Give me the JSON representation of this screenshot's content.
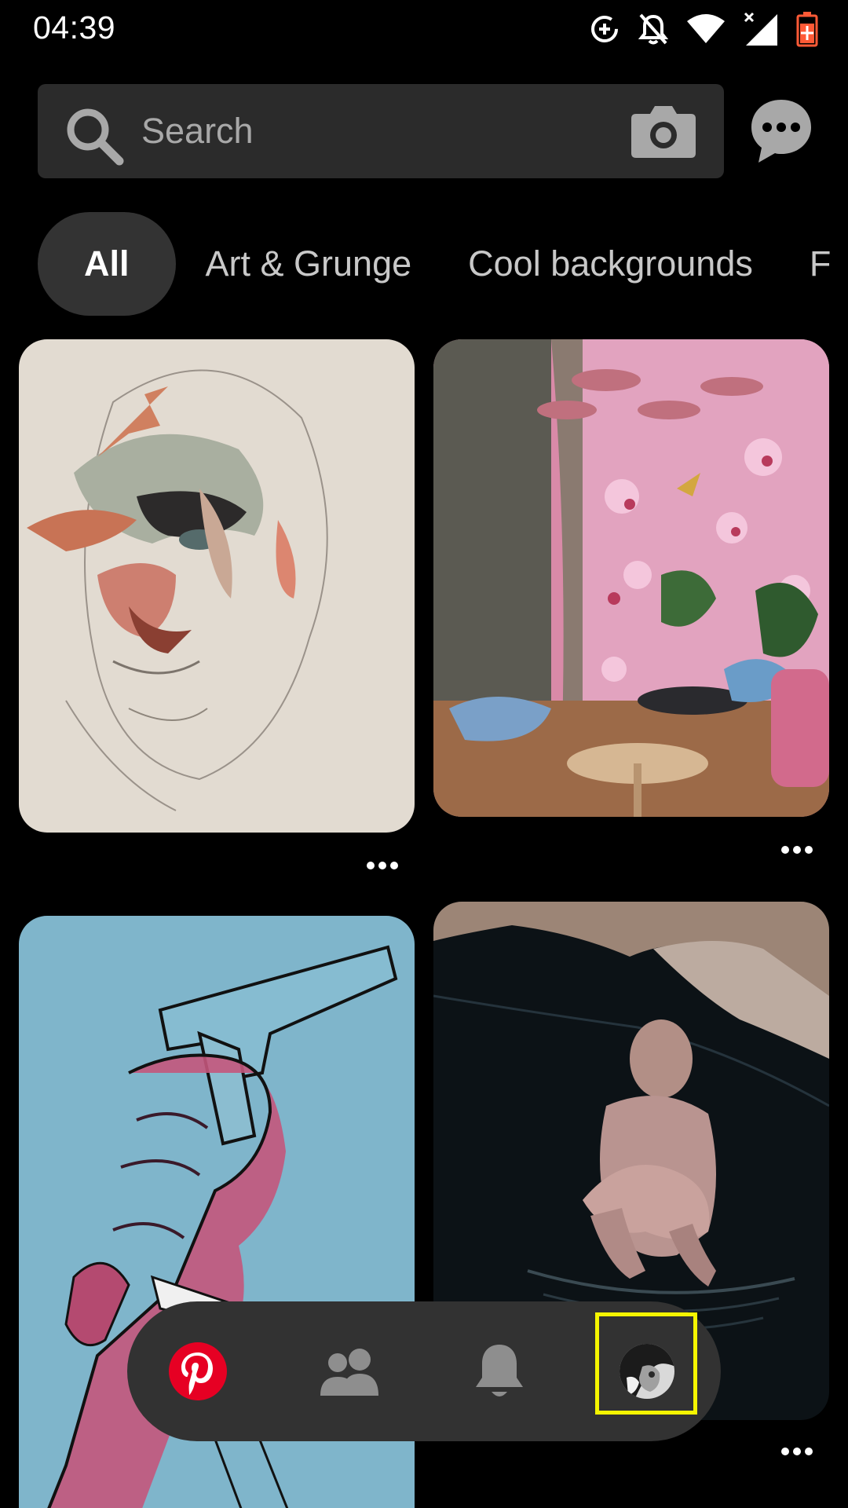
{
  "status_bar": {
    "time": "04:39",
    "icons": [
      "data-saver-icon",
      "notifications-off-icon",
      "wifi-icon",
      "cell-signal-icon",
      "battery-charging-icon"
    ]
  },
  "search": {
    "placeholder": "Search",
    "camera_icon": "camera-icon",
    "messages_icon": "chat-bubble-icon"
  },
  "tabs": {
    "items": [
      "All",
      "Art & Grunge",
      "Cool backgrounds",
      "F"
    ],
    "active": "All"
  },
  "feed": {
    "pins": [
      {
        "name": "pin-painted-face-portrait",
        "column": "left"
      },
      {
        "name": "pin-pink-floral-cafe-interior",
        "column": "right"
      },
      {
        "name": "pin-hand-holding-gun-illustration",
        "column": "left"
      },
      {
        "name": "pin-figure-sitting-in-water-painting",
        "column": "right"
      }
    ]
  },
  "bottom_nav": {
    "items": [
      "pinterest-home-icon",
      "following-people-icon",
      "notifications-bell-icon",
      "profile-avatar"
    ],
    "highlighted": "profile-avatar",
    "colors": {
      "brand": "#e60023",
      "icon": "#8e8e8e",
      "highlight": "#f5f500"
    }
  }
}
